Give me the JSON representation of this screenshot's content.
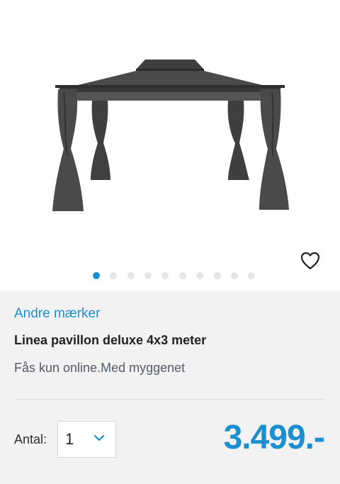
{
  "product": {
    "brand_link": "Andre mærker",
    "name": "Linea pavillon deluxe 4x3 meter",
    "subtitle": "Fås kun online.Med myggenet",
    "price": "3.499.-"
  },
  "gallery": {
    "image_icon": "gazebo-with-curtains",
    "favorite_icon": "heart-outline-icon",
    "slide_count": 10,
    "active_slide": 1
  },
  "quantity": {
    "label": "Antal:",
    "value": "1",
    "icon": "chevron-down-icon"
  },
  "colors": {
    "accent": "#1b8fcf",
    "dot_inactive": "#e3e5e8",
    "background": "#f2f2f2"
  }
}
